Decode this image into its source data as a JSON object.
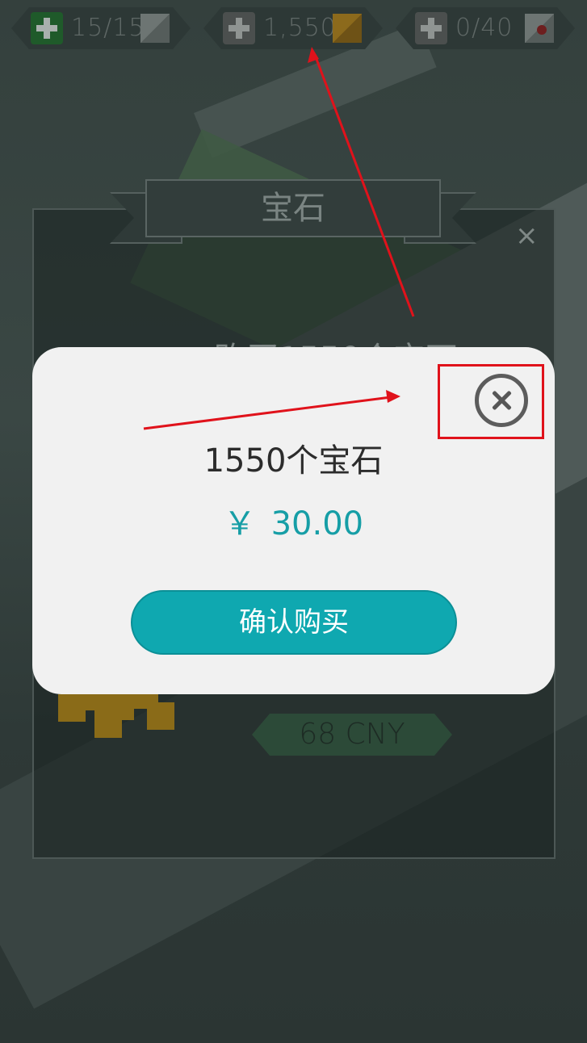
{
  "resources": [
    {
      "value": "15/15",
      "icon": "health-cube-icon"
    },
    {
      "value": "1,550",
      "icon": "gem-cube-icon"
    },
    {
      "value": "0/40",
      "icon": "heart-cube-icon"
    }
  ],
  "background_panel": {
    "title": "宝石",
    "partial_text": "购买1550个宝石",
    "offer_price": "68 CNY",
    "close_icon": "×"
  },
  "dialog": {
    "title": "1550个宝石",
    "price": "￥ 30.00",
    "confirm_label": "确认购买",
    "close_icon": "close-circle-icon"
  },
  "colors": {
    "dialog_bg": "#f1f1f1",
    "price_color": "#169ea6",
    "button_bg": "#0fa8b0",
    "annotation": "#e0121b"
  }
}
